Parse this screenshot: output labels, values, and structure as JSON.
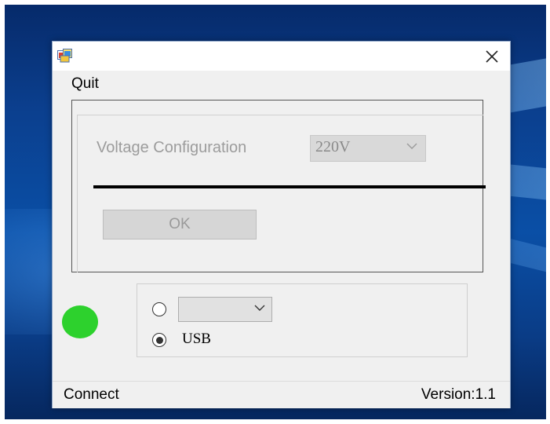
{
  "window": {
    "close_glyph": "✕"
  },
  "menu": {
    "quit_label": "Quit"
  },
  "voltage": {
    "label": "Voltage Configuration",
    "selected_value": "220V",
    "ok_label": "OK"
  },
  "connection": {
    "status_color": "#2dd12d",
    "port_selected": "",
    "serial_radio_checked": false,
    "usb_radio_checked": true,
    "usb_label": "USB"
  },
  "statusbar": {
    "connect_label": "Connect",
    "version_label": "Version:1.1"
  }
}
